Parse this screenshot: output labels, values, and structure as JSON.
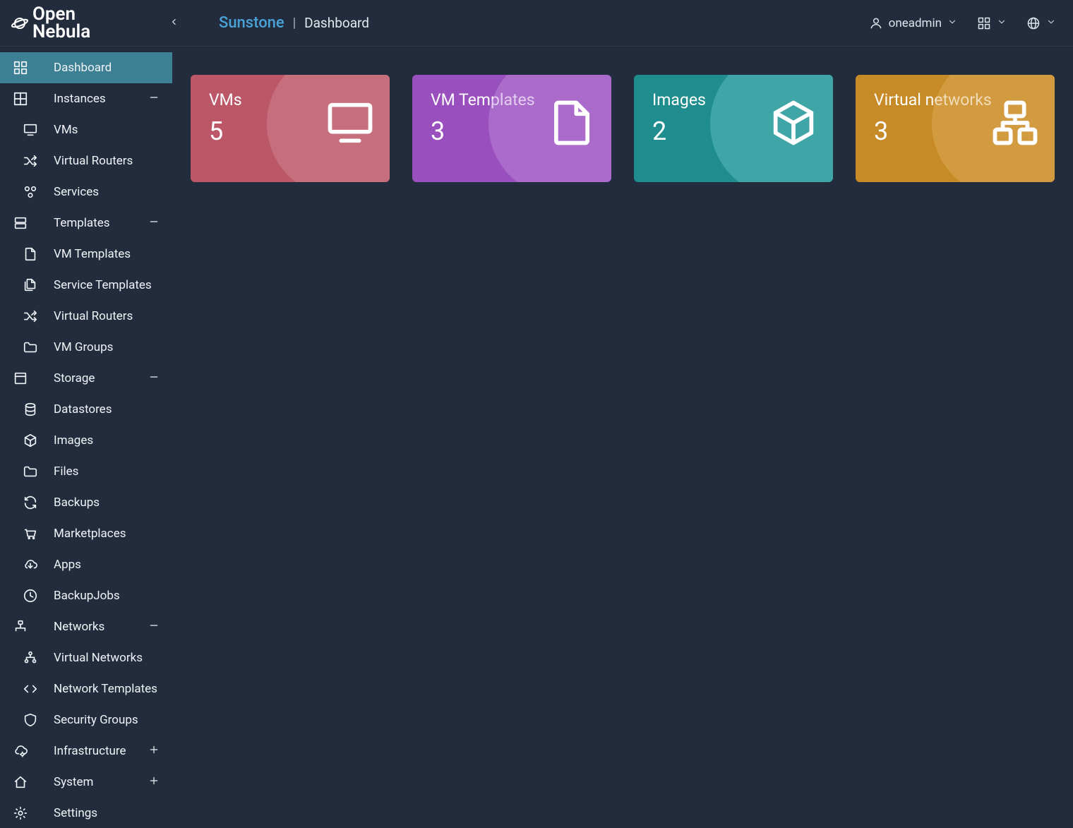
{
  "brand": "Sunstone",
  "logo_text_1": "Open",
  "logo_text_2": "Nebula",
  "page_title": "Dashboard",
  "user": "oneadmin",
  "sidebar": {
    "dashboard": "Dashboard",
    "instances": {
      "label": "Instances",
      "vms": "VMs",
      "vrouters": "Virtual Routers",
      "services": "Services"
    },
    "templates": {
      "label": "Templates",
      "vmtemplates": "VM Templates",
      "servicetemplates": "Service Templates",
      "vrouters": "Virtual Routers",
      "vmgroups": "VM Groups"
    },
    "storage": {
      "label": "Storage",
      "datastores": "Datastores",
      "images": "Images",
      "files": "Files",
      "backups": "Backups",
      "marketplaces": "Marketplaces",
      "apps": "Apps",
      "backupjobs": "BackupJobs"
    },
    "networks": {
      "label": "Networks",
      "vnets": "Virtual Networks",
      "nettemplates": "Network Templates",
      "secgroups": "Security Groups"
    },
    "infrastructure": "Infrastructure",
    "system": "System",
    "settings": "Settings"
  },
  "cards": {
    "vms": {
      "title": "VMs",
      "value": "5"
    },
    "templates": {
      "title": "VM Templates",
      "value": "3"
    },
    "images": {
      "title": "Images",
      "value": "2"
    },
    "networks": {
      "title": "Virtual networks",
      "value": "3"
    }
  }
}
